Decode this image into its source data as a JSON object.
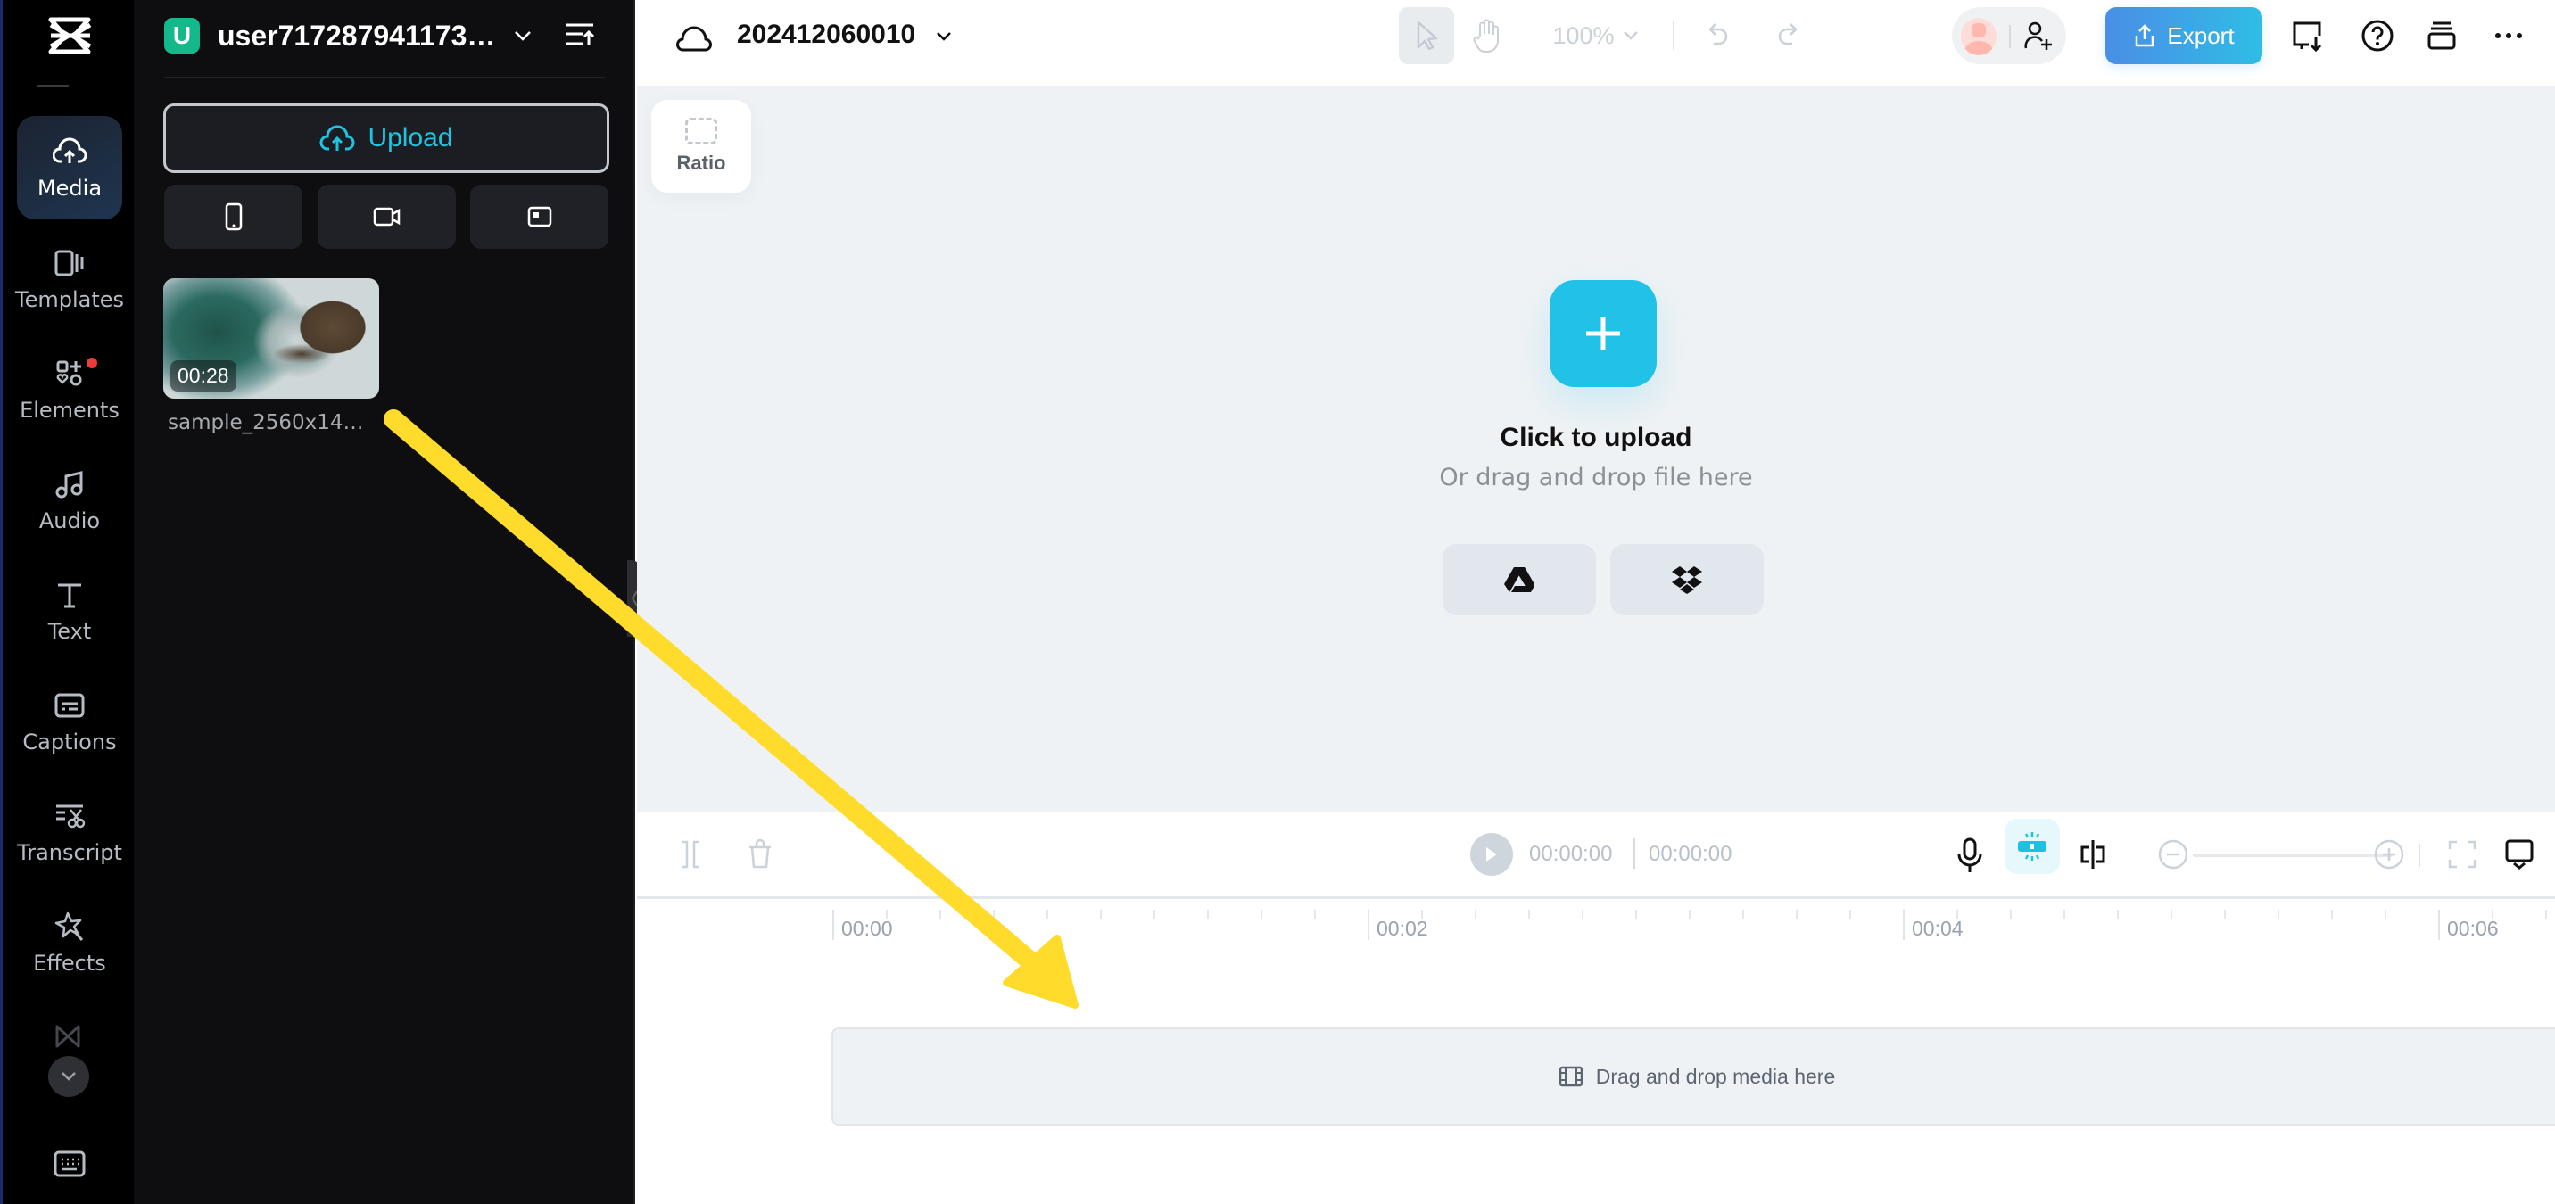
{
  "nav": {
    "items": [
      {
        "label": "Media",
        "icon": "cloud-upload-icon",
        "active": true
      },
      {
        "label": "Templates",
        "icon": "templates-icon"
      },
      {
        "label": "Elements",
        "icon": "elements-icon",
        "badge": true
      },
      {
        "label": "Audio",
        "icon": "music-note-icon"
      },
      {
        "label": "Text",
        "icon": "text-icon"
      },
      {
        "label": "Captions",
        "icon": "captions-icon"
      },
      {
        "label": "Transcript",
        "icon": "transcript-icon"
      },
      {
        "label": "Effects",
        "icon": "effects-icon"
      }
    ]
  },
  "panel": {
    "user_initial": "U",
    "username": "user7172879411732'...",
    "upload_label": "Upload",
    "media": [
      {
        "name": "sample_2560x144...",
        "duration": "00:28"
      }
    ]
  },
  "topbar": {
    "project_name": "202412060010",
    "zoom_level": "100%",
    "export_label": "Export"
  },
  "canvas": {
    "ratio_label": "Ratio",
    "upload_title": "Click to upload",
    "upload_subtitle": "Or drag and drop file here"
  },
  "timeline": {
    "current_time": "00:00:00",
    "total_time": "00:00:00",
    "ruler_labels": [
      "00:00",
      "00:02",
      "00:04",
      "00:06"
    ],
    "drop_label": "Drag and drop media here"
  },
  "colors": {
    "accent": "#21c1e8",
    "export_start": "#4a8ee6",
    "export_end": "#2fbde6",
    "annotation_arrow": "#ffdb2b",
    "badge": "#f03a3a"
  }
}
